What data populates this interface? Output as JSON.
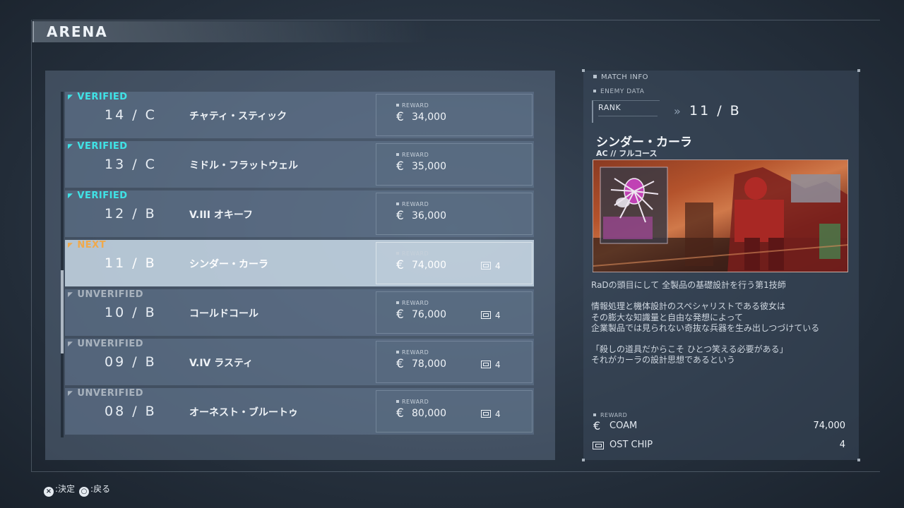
{
  "header": {
    "title": "ARENA"
  },
  "list": [
    {
      "status": "VERIFIED",
      "rank": "14 / C",
      "name": "チャティ・スティック",
      "reward_label": "REWARD",
      "currency": "€",
      "amount": "34,000",
      "chip": ""
    },
    {
      "status": "VERIFIED",
      "rank": "13 / C",
      "name": "ミドル・フラットウェル",
      "reward_label": "REWARD",
      "currency": "€",
      "amount": "35,000",
      "chip": ""
    },
    {
      "status": "VERIFIED",
      "rank": "12 / B",
      "name": "V.III オキーフ",
      "reward_label": "REWARD",
      "currency": "€",
      "amount": "36,000",
      "chip": ""
    },
    {
      "status": "NEXT",
      "rank": "11 / B",
      "name": "シンダー・カーラ",
      "reward_label": "REWARD",
      "currency": "€",
      "amount": "74,000",
      "chip": "4"
    },
    {
      "status": "UNVERIFIED",
      "rank": "10 / B",
      "name": "コールドコール",
      "reward_label": "REWARD",
      "currency": "€",
      "amount": "76,000",
      "chip": "4"
    },
    {
      "status": "UNVERIFIED",
      "rank": "09 / B",
      "name": "V.IV ラスティ",
      "reward_label": "REWARD",
      "currency": "€",
      "amount": "78,000",
      "chip": "4"
    },
    {
      "status": "UNVERIFIED",
      "rank": "08 / B",
      "name": "オーネスト・ブルートゥ",
      "reward_label": "REWARD",
      "currency": "€",
      "amount": "80,000",
      "chip": "4"
    }
  ],
  "info": {
    "match_info_label": "MATCH INFO",
    "enemy_data_label": "ENEMY DATA",
    "rank_label": "RANK",
    "rank_arrows": "»",
    "rank_value": "11 / B",
    "enemy_name": "シンダー・カーラ",
    "enemy_sub": "AC //  フルコース",
    "description": [
      "RaDの頭目にして 全製品の基礎設計を行う第1技師",
      "情報処理と機体設計のスペシャリストである彼女は",
      "その膨大な知識量と自由な発想によって",
      "企業製品では見られない奇抜な兵器を生み出しつづけている",
      "「殺しの道具だからこそ ひとつ笑える必要がある」",
      "それがカーラの設計思想であるという"
    ],
    "reward_label": "REWARD",
    "rewards": [
      {
        "icon": "€",
        "name": "COAM",
        "value": "74,000"
      },
      {
        "icon": "chip",
        "name": "OST CHIP",
        "value": "4"
      }
    ]
  },
  "footer": {
    "confirm_button": "×",
    "confirm_label": ":決定",
    "back_button": "○",
    "back_label": ":戻る"
  },
  "colors": {
    "verified": "#3fe3e6",
    "next": "#f0a94b",
    "unverified": "#a9b3be"
  }
}
